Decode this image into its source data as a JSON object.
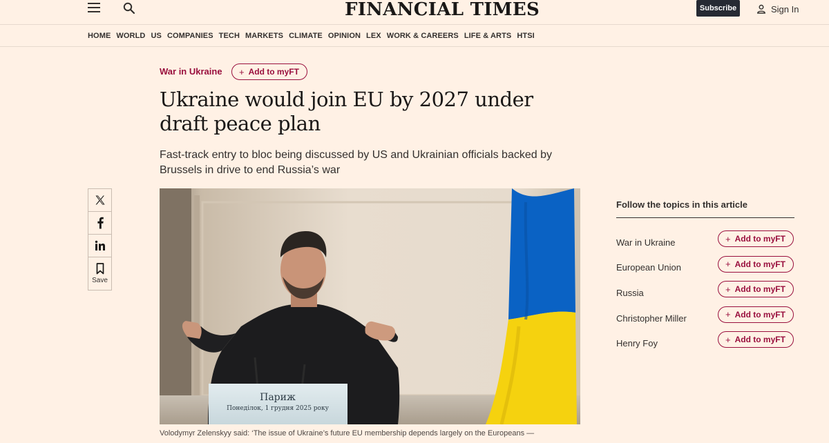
{
  "header": {
    "logo": "FINANCIAL TIMES",
    "subscribe_label": "Subscribe",
    "signin_label": "Sign In"
  },
  "nav": {
    "items": [
      "HOME",
      "WORLD",
      "US",
      "COMPANIES",
      "TECH",
      "MARKETS",
      "CLIMATE",
      "OPINION",
      "LEX",
      "WORK & CAREERS",
      "LIFE & ARTS",
      "HTSI"
    ]
  },
  "article": {
    "topic": "War in Ukraine",
    "add_myft_label": "Add to myFT",
    "headline": "Ukraine would join EU by 2027 under draft peace plan",
    "standfirst": "Fast-track entry to bloc being discussed by US and Ukrainian officials backed by Brussels in drive to end Russia’s war",
    "image": {
      "podium_line1": "Париж",
      "podium_line2": "Понеділок, 1 грудня 2025 року"
    },
    "caption": "Volodymyr Zelenskyy said: ‘The issue of Ukraine’s future EU membership depends largely on the Europeans —"
  },
  "share": {
    "save_label": "Save"
  },
  "sidebar": {
    "title": "Follow the topics in this article",
    "topics": [
      {
        "name": "War in Ukraine",
        "button": "Add to myFT"
      },
      {
        "name": "European Union",
        "button": "Add to myFT"
      },
      {
        "name": "Russia",
        "button": "Add to myFT"
      },
      {
        "name": "Christopher Miller",
        "button": "Add to myFT"
      },
      {
        "name": "Henry Foy",
        "button": "Add to myFT"
      }
    ]
  },
  "colors": {
    "background": "#fff1e5",
    "claret": "#990f3d",
    "subscribe_bg": "#262a33",
    "flag_blue": "#0a62c4",
    "flag_yellow": "#f5d20f"
  },
  "icons": [
    "menu-icon",
    "search-icon",
    "user-icon",
    "x-icon",
    "facebook-icon",
    "linkedin-icon",
    "bookmark-icon",
    "plus-icon"
  ]
}
